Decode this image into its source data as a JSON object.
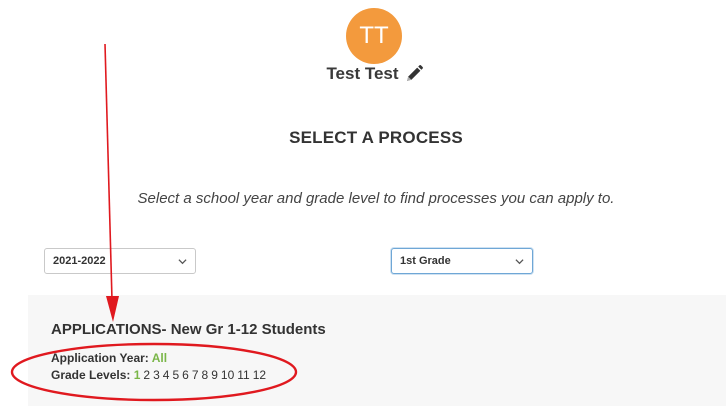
{
  "user": {
    "initials": "TT",
    "name": "Test Test",
    "avatar_color": "#f39a3d",
    "edit_icon": "pencil-icon"
  },
  "process": {
    "title": "SELECT A PROCESS",
    "instructions": "Select a school year and grade level to find processes you can apply to."
  },
  "filters": {
    "school_year": "2021-2022",
    "grade_level": "1st Grade"
  },
  "application": {
    "title": "APPLICATIONS- New Gr 1-12 Students",
    "year_label": "Application Year:",
    "year_value": "All",
    "grades_label": "Grade Levels:",
    "grades": [
      "1",
      "2",
      "3",
      "4",
      "5",
      "6",
      "7",
      "8",
      "9",
      "10",
      "11",
      "12"
    ],
    "active_grade_index": 0,
    "accent_color": "#7ab648"
  },
  "annotation_color": "#e0191f"
}
